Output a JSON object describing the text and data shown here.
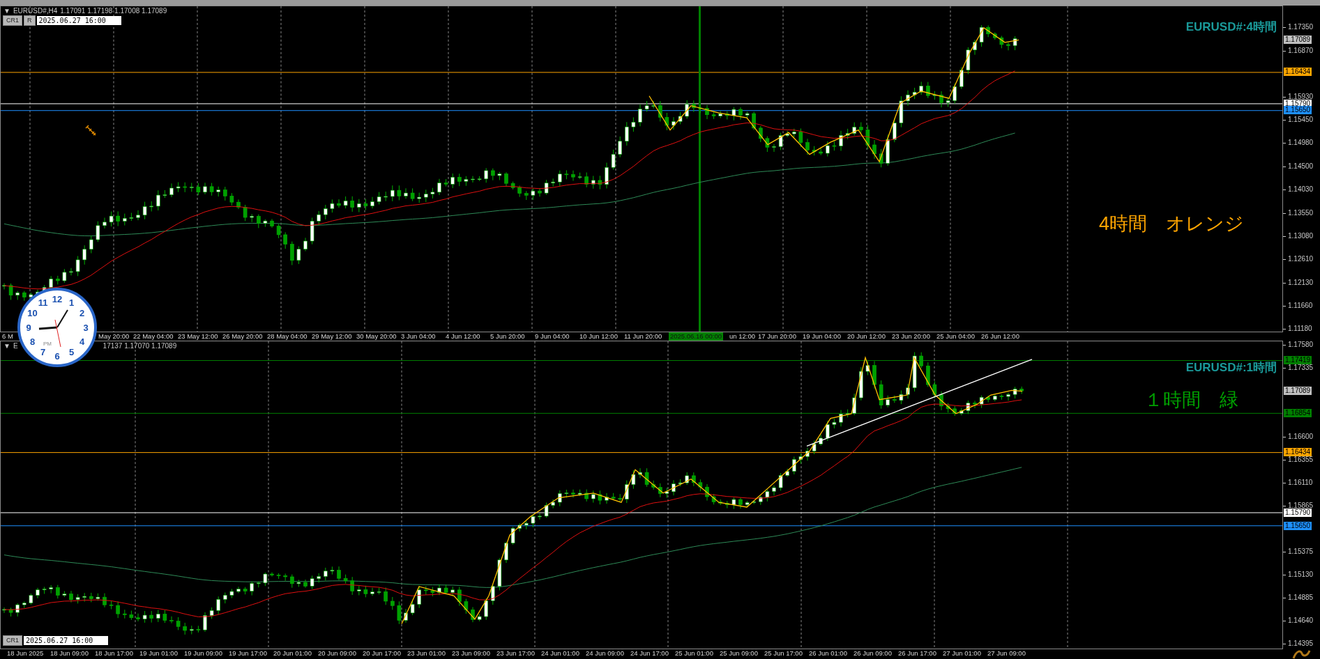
{
  "panes": [
    {
      "header": {
        "kind": "inline",
        "marker": "▼",
        "symbol": "EURUSD#,H4",
        "prices": "1.17091 1.17198 1.17008 1.17089"
      },
      "controls": [
        "CR1",
        "R"
      ],
      "date_field": "2025.06.27 16:00",
      "title": "EURUSD#:4時間",
      "note": {
        "text": "4時間　オレンジ",
        "color": "#ffa500"
      },
      "price_ticks": [
        "1.17350",
        "1.16870",
        "1.15930",
        "1.15450",
        "1.14980",
        "1.14500",
        "1.14030",
        "1.13550",
        "1.13080",
        "1.12610",
        "1.12130",
        "1.11660",
        "1.11180"
      ],
      "price_tags": [
        {
          "label": "1.17089",
          "color": "#c0c0c0",
          "kind": "current"
        },
        {
          "label": "1.16434",
          "color": "#ffa500",
          "kind": "level"
        },
        {
          "label": "1.15790",
          "color": "#ffffff",
          "kind": "level"
        },
        {
          "label": "1.15650",
          "color": "#1e90ff",
          "kind": "level"
        }
      ],
      "time_labels": [
        {
          "label": "6 M",
          "kind": "cut"
        },
        {
          "label": "May 20:00",
          "kind": "cut"
        },
        {
          "label": "22 May 04:00",
          "kind": "normal"
        },
        {
          "label": "23 May 12:00",
          "kind": "normal"
        },
        {
          "label": "26 May 20:00",
          "kind": "normal"
        },
        {
          "label": "28 May 04:00",
          "kind": "normal"
        },
        {
          "label": "29 May 12:00",
          "kind": "normal"
        },
        {
          "label": "30 May 20:00",
          "kind": "normal"
        },
        {
          "label": "3 Jun 04:00",
          "kind": "normal"
        },
        {
          "label": "4 Jun 12:00",
          "kind": "normal"
        },
        {
          "label": "5 Jun 20:00",
          "kind": "normal"
        },
        {
          "label": "9 Jun 04:00",
          "kind": "normal"
        },
        {
          "label": "10 Jun 12:00",
          "kind": "normal"
        },
        {
          "label": "11 Jun 20:00",
          "kind": "normal"
        },
        {
          "label": "2025.06.16 00:00",
          "kind": "highlight"
        },
        {
          "label": "un 12:00",
          "kind": "normal"
        },
        {
          "label": "17 Jun 20:00",
          "kind": "normal"
        },
        {
          "label": "19 Jun 04:00",
          "kind": "normal"
        },
        {
          "label": "20 Jun 12:00",
          "kind": "normal"
        },
        {
          "label": "23 Jun 20:00",
          "kind": "normal"
        },
        {
          "label": "25 Jun 04:00",
          "kind": "normal"
        },
        {
          "label": "26 Jun 12:00",
          "kind": "normal"
        }
      ]
    },
    {
      "header": {
        "kind": "split",
        "marker": "▼",
        "symbol": "E",
        "prices": "17137 1.17070 1.17089"
      },
      "controls": [
        "CR1"
      ],
      "date_field": "2025.06.27 16:00",
      "title": "EURUSD#:1時間",
      "note": {
        "text": "１時間　緑",
        "color": "#00a000"
      },
      "price_ticks": [
        "1.17580",
        "1.17335",
        "1.16600",
        "1.16355",
        "1.16110",
        "1.15865",
        "1.15375",
        "1.15130",
        "1.14885",
        "1.14640",
        "1.14395"
      ],
      "price_tags": [
        {
          "label": "1.17419",
          "color": "#008000",
          "kind": "level"
        },
        {
          "label": "1.17089",
          "color": "#c0c0c0",
          "kind": "current"
        },
        {
          "label": "1.16854",
          "color": "#008000",
          "kind": "level"
        },
        {
          "label": "1.16434",
          "color": "#ffa500",
          "kind": "level"
        },
        {
          "label": "1.15790",
          "color": "#ffffff",
          "kind": "level"
        },
        {
          "label": "1.15650",
          "color": "#1e90ff",
          "kind": "level"
        }
      ],
      "time_labels": [
        {
          "label": "18 Jun 2025",
          "kind": "normal"
        },
        {
          "label": "18 Jun 09:00",
          "kind": "normal"
        },
        {
          "label": "18 Jun 17:00",
          "kind": "normal"
        },
        {
          "label": "19 Jun 01:00",
          "kind": "normal"
        },
        {
          "label": "19 Jun 09:00",
          "kind": "normal"
        },
        {
          "label": "19 Jun 17:00",
          "kind": "normal"
        },
        {
          "label": "20 Jun 01:00",
          "kind": "normal"
        },
        {
          "label": "20 Jun 09:00",
          "kind": "normal"
        },
        {
          "label": "20 Jun 17:00",
          "kind": "normal"
        },
        {
          "label": "23 Jun 01:00",
          "kind": "normal"
        },
        {
          "label": "23 Jun 09:00",
          "kind": "normal"
        },
        {
          "label": "23 Jun 17:00",
          "kind": "normal"
        },
        {
          "label": "24 Jun 01:00",
          "kind": "normal"
        },
        {
          "label": "24 Jun 09:00",
          "kind": "normal"
        },
        {
          "label": "24 Jun 17:00",
          "kind": "normal"
        },
        {
          "label": "25 Jun 01:00",
          "kind": "normal"
        },
        {
          "label": "25 Jun 09:00",
          "kind": "normal"
        },
        {
          "label": "25 Jun 17:00",
          "kind": "normal"
        },
        {
          "label": "26 Jun 01:00",
          "kind": "normal"
        },
        {
          "label": "26 Jun 09:00",
          "kind": "normal"
        },
        {
          "label": "26 Jun 17:00",
          "kind": "normal"
        },
        {
          "label": "27 Jun 01:00",
          "kind": "normal"
        },
        {
          "label": "27 Jun 09:00",
          "kind": "normal"
        }
      ]
    }
  ],
  "clock": {
    "numerals": [
      "12",
      "11",
      "1",
      "10",
      "2",
      "9",
      "3",
      "8",
      "4",
      "7",
      "5",
      "6"
    ],
    "period": "PM"
  }
}
